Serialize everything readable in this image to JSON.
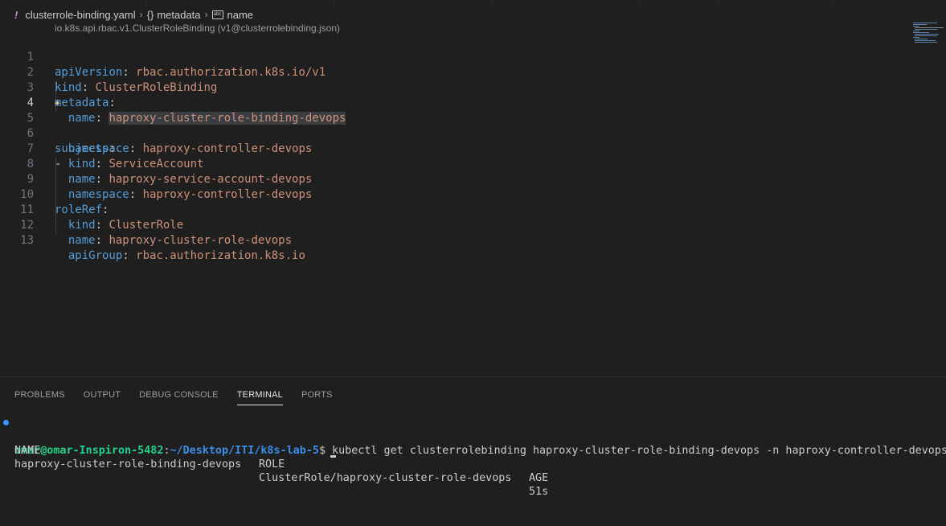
{
  "breadcrumb": {
    "file": "clusterrole-binding.yaml",
    "node1": "metadata",
    "node2": "name",
    "schema": "io.k8s.api.rbac.v1.ClusterRoleBinding (v1@clusterrolebinding.json)"
  },
  "code": {
    "lines": [
      {
        "n": "1",
        "key": "apiVersion",
        "val": "rbac.authorization.k8s.io/v1"
      },
      {
        "n": "2",
        "key": "kind",
        "val": "ClusterRoleBinding"
      },
      {
        "n": "3",
        "key": "metadata"
      },
      {
        "n": "4",
        "key": "name",
        "val": "haproxy-cluster-role-binding-devops"
      },
      {
        "n": "5",
        "key": "namespace",
        "val": "haproxy-controller-devops"
      },
      {
        "n": "6",
        "key": "subjects"
      },
      {
        "n": "7",
        "key": "kind",
        "val": "ServiceAccount",
        "dash": "- "
      },
      {
        "n": "8",
        "key": "name",
        "val": "haproxy-service-account-devops"
      },
      {
        "n": "9",
        "key": "namespace",
        "val": "haproxy-controller-devops"
      },
      {
        "n": "10",
        "key": "roleRef"
      },
      {
        "n": "11",
        "key": "kind",
        "val": "ClusterRole"
      },
      {
        "n": "12",
        "key": "name",
        "val": "haproxy-cluster-role-devops"
      },
      {
        "n": "13",
        "key": "apiGroup",
        "val": "rbac.authorization.k8s.io"
      }
    ]
  },
  "panel": {
    "tabs": [
      "PROBLEMS",
      "OUTPUT",
      "DEBUG CONSOLE",
      "TERMINAL",
      "PORTS"
    ],
    "active_tab": "TERMINAL"
  },
  "terminal": {
    "user": "omar@omar-Inspiron-5482",
    "path": "~/Desktop/ITI/k8s-lab-5",
    "command": "$ kubectl get clusterrolebinding haproxy-cluster-role-binding-devops -n haproxy-controller-devops",
    "headers": [
      "NAME",
      "ROLE",
      "AGE"
    ],
    "row": [
      "haproxy-cluster-role-binding-devops",
      "ClusterRole/haproxy-cluster-role-devops",
      "51s"
    ]
  },
  "colors": {
    "key": "#569cd6",
    "value": "#ce9178",
    "prompt_user": "#23d18b",
    "prompt_path": "#3b8eea"
  },
  "icons": [
    "warning-icon",
    "chevron-right-icon",
    "braces-icon",
    "abc-icon",
    "sparkle-icon",
    "terminal-status-dot-icon"
  ]
}
